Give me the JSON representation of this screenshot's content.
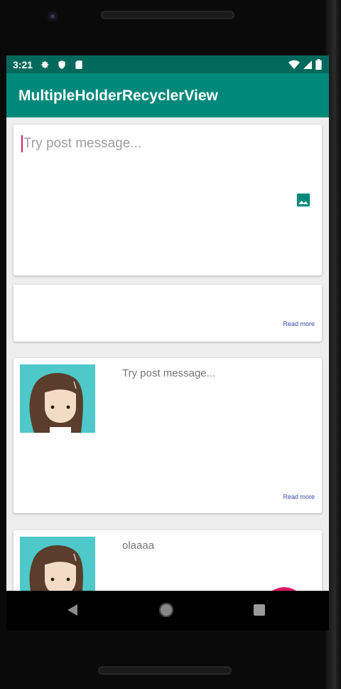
{
  "status_bar": {
    "time": "3:21",
    "left_icons": [
      "settings-icon",
      "shield-icon",
      "sd-card-icon"
    ],
    "right_icons": [
      "wifi-icon",
      "signal-icon",
      "battery-icon"
    ]
  },
  "app_bar": {
    "title": "MultipleHolderRecyclerView"
  },
  "composer": {
    "placeholder": "Try post message...",
    "image_button_icon": "image-icon"
  },
  "posts": [
    {
      "text": "",
      "read_more": "Read more",
      "has_avatar": false
    },
    {
      "text": "Try post message...",
      "read_more": "Read more",
      "has_avatar": true
    },
    {
      "text": "olaaaa",
      "has_avatar": true
    }
  ],
  "fab": {
    "icon": "send-icon"
  },
  "nav_bar": {
    "icons": [
      "back-icon",
      "home-icon",
      "recents-icon"
    ]
  },
  "colors": {
    "status_bar": "#00695c",
    "app_bar": "#00897b",
    "accent": "#d81b60",
    "read_more": "#3949ab",
    "avatar_bg": "#4fc8c9"
  }
}
